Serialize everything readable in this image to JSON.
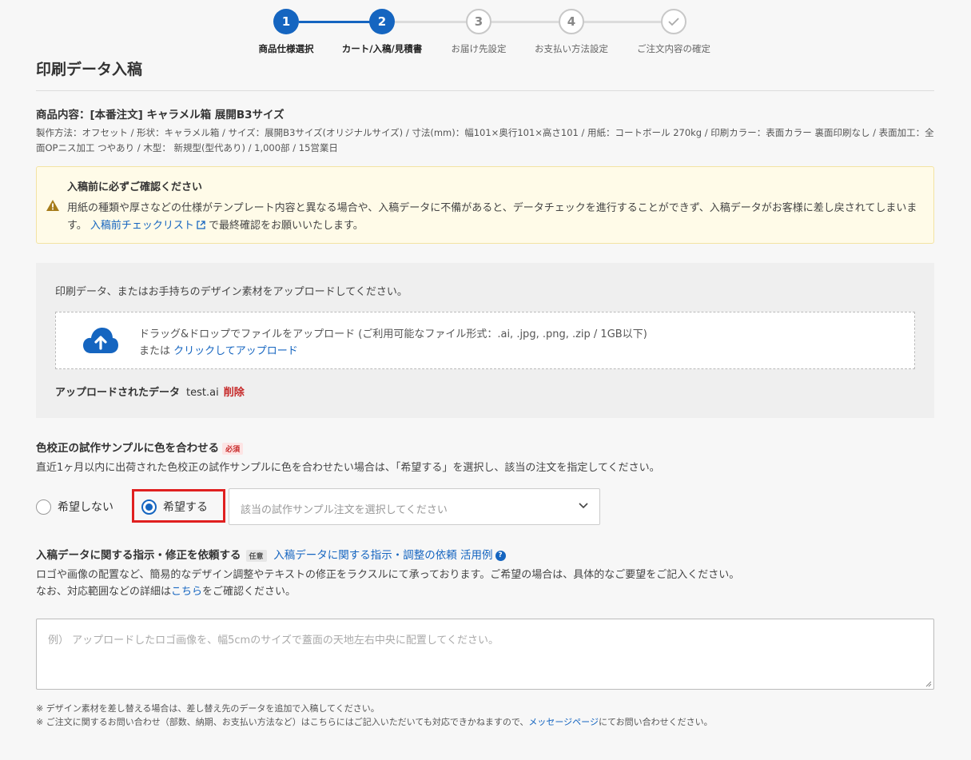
{
  "stepper": {
    "steps": [
      {
        "number": "1",
        "label": "商品仕様選択",
        "state": "active"
      },
      {
        "number": "2",
        "label": "カート/入稿/見積書",
        "state": "active"
      },
      {
        "number": "3",
        "label": "お届け先設定",
        "state": "todo"
      },
      {
        "number": "4",
        "label": "お支払い方法設定",
        "state": "todo"
      },
      {
        "number": "",
        "label": "ご注文内容の確定",
        "state": "todo",
        "icon": "check-icon"
      }
    ],
    "accent": "#1565c0"
  },
  "page": {
    "title": "印刷データ入稿"
  },
  "product": {
    "title": "商品内容：[本番注文] キャラメル箱 展開B3サイズ",
    "spec": "製作方法：オフセット / 形状：キャラメル箱 / サイズ：展開B3サイズ(オリジナルサイズ) / 寸法(mm)：幅101×奥行101×高さ101 / 用紙：コートボール 270kg / 印刷カラー：表面カラー 裏面印刷なし / 表面加工：全面OPニス加工 つやあり / 木型： 新規型(型代あり) / 1,000部 / 15営業日"
  },
  "notice": {
    "icon": "warning-icon",
    "title": "入稿前に必ずご確認ください",
    "body_before": "用紙の種類や厚さなどの仕様がテンプレート内容と異なる場合や、入稿データに不備があると、データチェックを進行することができず、入稿データがお客様に差し戻されてしまいます。",
    "link": "入稿前チェックリスト",
    "body_after": "で最終確認をお願いいたします。"
  },
  "upload": {
    "intro": "印刷データ、またはお手持ちのデザイン素材をアップロードしてください。",
    "drop_text": "ドラッグ&ドロップでファイルをアップロード (ご利用可能なファイル形式：.ai, .jpg, .png, .zip / 1GB以下)",
    "or_text": "または",
    "click_link": "クリックしてアップロード",
    "uploaded_label": "アップロードされたデータ",
    "uploaded_file": "test.ai",
    "delete_label": "削除"
  },
  "color_sample": {
    "title": "色校正の試作サンプルに色を合わせる",
    "badge": "必須",
    "description": "直近1ヶ月以内に出荷された色校正の試作サンプルに色を合わせたい場合は、「希望する」を選択し、該当の注文を指定してください。",
    "option_no": "希望しない",
    "option_yes": "希望する",
    "selected": "希望する",
    "select_placeholder": "該当の試作サンプル注文を選択してください"
  },
  "instructions": {
    "title": "入稿データに関する指示・修正を依頼する",
    "badge": "任意",
    "example_link": "入稿データに関する指示・調整の依頼 活用例",
    "desc_line1": "ロゴや画像の配置など、簡易的なデザイン調整やテキストの修正をラクスルにて承っております。ご希望の場合は、具体的なご要望をご記入ください。",
    "desc_line2_before": "なお、対応範囲などの詳細は",
    "desc_line2_link": "こちら",
    "desc_line2_after": "をご確認ください。",
    "textarea_placeholder": "例） アップロードしたロゴ画像を、幅5cmのサイズで蓋面の天地左右中央に配置してください。",
    "textarea_value": ""
  },
  "notes": {
    "note1": "※ デザイン素材を差し替える場合は、差し替え先のデータを追加で入稿してください。",
    "note2_before": "※ ご注文に関するお問い合わせ（部数、納期、お支払い方法など）はこちらにはご記入いただいても対応できかねますので、",
    "note2_link": "メッセージページ",
    "note2_after": "にてお問い合わせください。"
  }
}
